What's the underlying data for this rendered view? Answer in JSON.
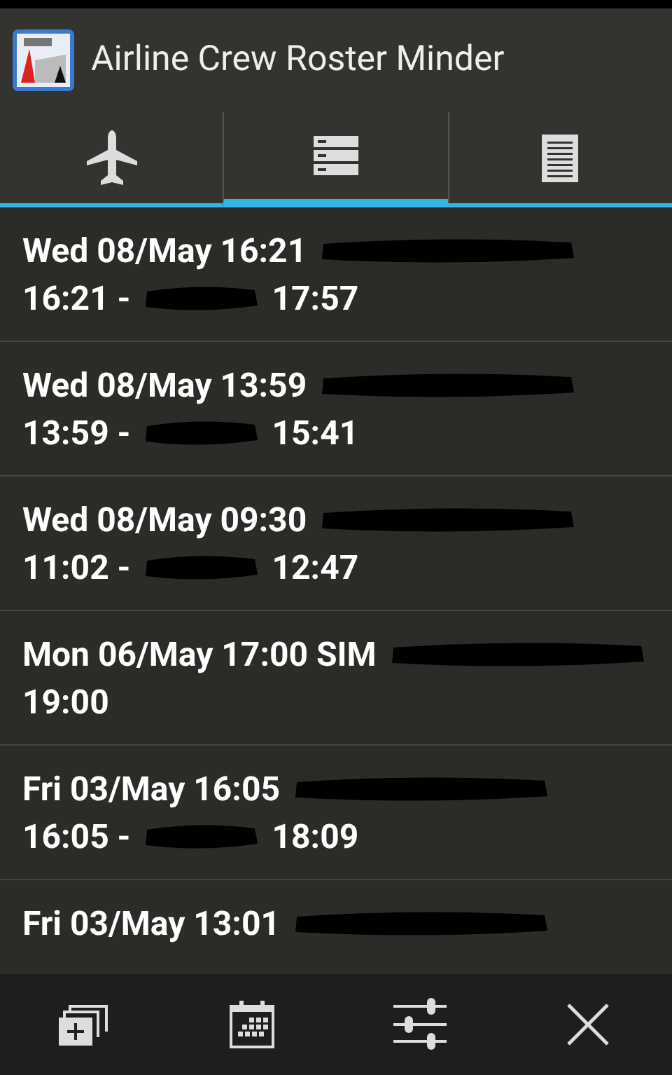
{
  "window": {
    "title": "Airline Crew Roster Minder"
  },
  "tabs": [
    {
      "kind": "plane",
      "selected": false
    },
    {
      "kind": "list",
      "selected": true
    },
    {
      "kind": "document",
      "selected": false
    }
  ],
  "rows": [
    {
      "header": "Wed 08/May 16:21",
      "start": "16:21 -",
      "route_redacted": true,
      "end": "17:57"
    },
    {
      "header": "Wed 08/May 13:59",
      "start": "13:59 -",
      "route_redacted": true,
      "end": "15:41"
    },
    {
      "header": "Wed 08/May 09:30",
      "start": "11:02 -",
      "route_redacted": true,
      "end": "12:47"
    },
    {
      "header": "Mon 06/May 17:00 SIM",
      "start": "19:00",
      "route_redacted": false
    },
    {
      "header": "Fri 03/May 16:05",
      "start": "16:05 -",
      "route_redacted": true,
      "end": "18:09"
    },
    {
      "header": "Fri 03/May 13:01"
    }
  ],
  "bottom_bar": [
    {
      "kind": "add"
    },
    {
      "kind": "calendar"
    },
    {
      "kind": "settings"
    },
    {
      "kind": "close"
    }
  ]
}
